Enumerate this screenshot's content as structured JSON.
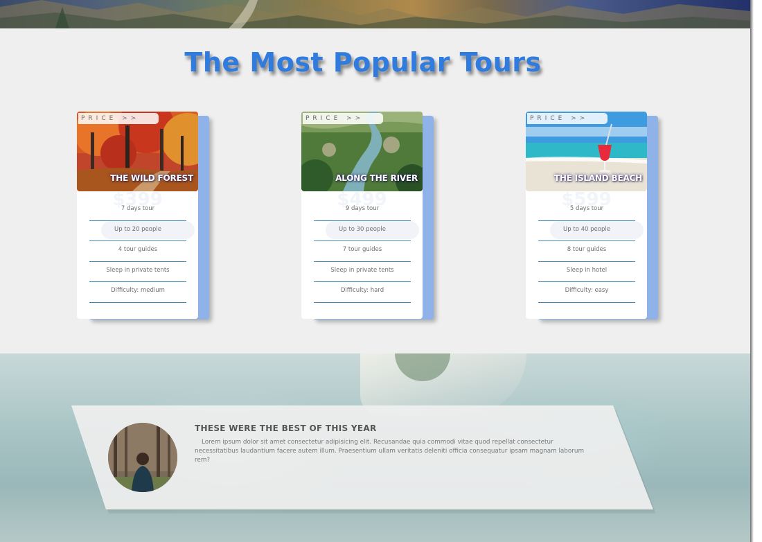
{
  "section_title": "The Most Popular Tours",
  "cards": [
    {
      "tab_label": "PRICE >>",
      "name": "THE WILD FOREST",
      "price": "$399",
      "details": [
        "7 days tour",
        "Up to 20 people",
        "4 tour guides",
        "Sleep in private tents",
        "Difficulty: medium"
      ]
    },
    {
      "tab_label": "PRICE >>",
      "name": "ALONG THE RIVER",
      "price": "$499",
      "details": [
        "9 days tour",
        "Up to 30 people",
        "7 tour guides",
        "Sleep in private tents",
        "Difficulty: hard"
      ]
    },
    {
      "tab_label": "PRICE >>",
      "name": "THE ISLAND BEACH",
      "price": "$599",
      "details": [
        "5 days tour",
        "Up to 40 people",
        "8 tour guides",
        "Sleep in hotel",
        "Difficulty: easy"
      ]
    }
  ],
  "story": {
    "heading": "THESE WERE THE BEST OF THIS YEAR",
    "body": "Lorem ipsum dolor sit amet consectetur adipisicing elit. Recusandae quia commodi vitae quod repellat consectetur necessitatibus laudantium facere autem illum. Praesentium ullam veritatis deleniti officia consequatur ipsam magnam laborum rem?"
  },
  "colors": {
    "title": "#2f7bde",
    "card_back": "#8fb2e8",
    "detail_rule": "#3c86b3"
  }
}
